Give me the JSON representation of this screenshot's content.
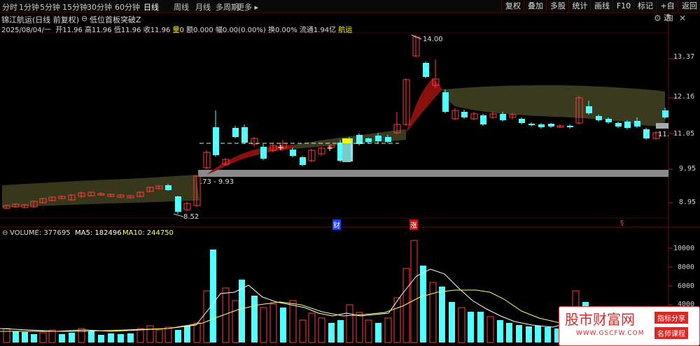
{
  "toolbar": {
    "periods": [
      "分时",
      "1分钟",
      "5分钟",
      "15分钟",
      "30分钟",
      "60分钟",
      "日线",
      "周线",
      "月线",
      "多周期",
      "更多"
    ],
    "active_period": "日线",
    "right_buttons": [
      "复权",
      "叠加",
      "多股",
      "统计",
      "画线",
      "F10",
      "标记",
      "+自选",
      "返回"
    ]
  },
  "info": {
    "stock_title": "锦江航运(日线 前复权)",
    "indicator_name": "低位首板突破Z",
    "date": "2025/08/04/一",
    "open_label": "开",
    "open": "11.96",
    "high_label": "高",
    "high": "11.96",
    "low_label": "低",
    "low": "11.96",
    "close_label": "收",
    "close": "11.96",
    "vol_label": "量",
    "vol": "0",
    "amount_label": "额",
    "amount": "0.000",
    "change_label": "幅",
    "change": "0.00(0.00%)",
    "turnover_label": "换",
    "turnover": "0.00%",
    "float_label": "流通",
    "float_cap": "1.94亿",
    "sector": "航运"
  },
  "price_axis": [
    "13.37",
    "12.16",
    "11.05",
    "9.95",
    "8.95"
  ],
  "annotations": {
    "high_marker": "14.00",
    "low_marker": "8.52",
    "range_label": ".73 - 9.93",
    "last_price": "11."
  },
  "event_markers": {
    "fin": "财",
    "zhang": "涨",
    "s": "§"
  },
  "volume_panel": {
    "label": "VOLUME: 377695",
    "ma5_label": "MA5: 182496",
    "ma10_label": "MA10: 244750",
    "axis": [
      "10000",
      "8000",
      "6000",
      "4000"
    ]
  },
  "watermark": {
    "site_name": "股市财富网",
    "site_url": "WWW.GSCFW.COM",
    "tag1": "指标分享",
    "tag2": "名师课程"
  },
  "colors": {
    "up": "#ff3b3b",
    "down": "#54ffff",
    "ma5": "#ffffff",
    "ma10": "#ffff66",
    "accent": "#ffff00"
  }
}
